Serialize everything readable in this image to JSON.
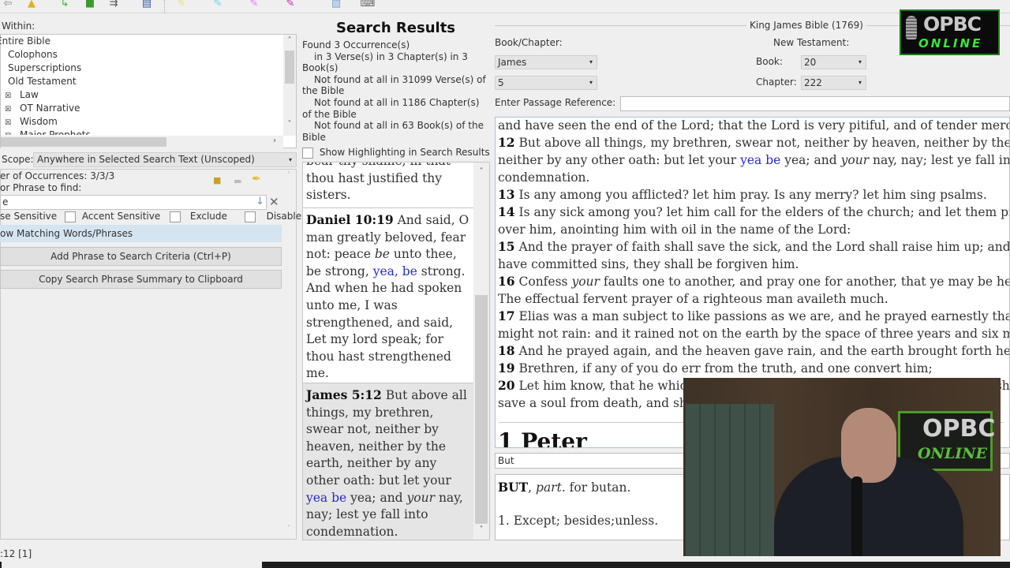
{
  "toolbar": {
    "icons": [
      "back-arrow-icon",
      "highlighter-eraser-icon",
      "green-arrow-forward-icon",
      "green-book-icon",
      "branch-arrow-icon",
      "window-layout-icon",
      "yellow-highlighter-icon",
      "cyan-highlighter-icon",
      "pink-highlighter-icon",
      "magenta-highlighter-icon",
      "notes-icon",
      "keyboard-icon"
    ]
  },
  "left": {
    "within_label": "Within:",
    "tree_items": [
      {
        "label": "Entire Bible",
        "checked": false,
        "indent": 0
      },
      {
        "label": "Colophons",
        "checked": false,
        "indent": 1
      },
      {
        "label": "Superscriptions",
        "checked": false,
        "indent": 1
      },
      {
        "label": "Old Testament",
        "checked": false,
        "indent": 1
      },
      {
        "label": "Law",
        "checked": true,
        "indent": 2
      },
      {
        "label": "OT Narrative",
        "checked": true,
        "indent": 2
      },
      {
        "label": "Wisdom",
        "checked": true,
        "indent": 2
      },
      {
        "label": "Major Prophets",
        "checked": true,
        "indent": 2
      }
    ],
    "scope_label": "Scope:",
    "scope_value": "Anywhere in Selected Search Text (Unscoped)",
    "occurrences_label": "er of Occurrences: 3/3/3",
    "phrase_label": "or Phrase to find:",
    "phrase_value": "e",
    "options": {
      "case_sensitive": "se Sensitive",
      "accent_sensitive": "Accent Sensitive",
      "exclude": "Exclude",
      "disable": "Disable"
    },
    "matching_label": "ow Matching Words/Phrases",
    "add_phrase_button": "Add Phrase to Search Criteria (Ctrl+P)",
    "copy_summary_button": "Copy Search Phrase Summary to Clipboard",
    "status": ":12 [1]"
  },
  "results": {
    "title": "Search Results",
    "summary": [
      {
        "text": "Found 3 Occurrence(s)",
        "indent": false
      },
      {
        "text": "in 3 Verse(s) in 3 Chapter(s) in 3 Book(s)",
        "indent": true
      },
      {
        "text": "Not found at all in 31099 Verse(s) of the Bible",
        "indent": true
      },
      {
        "text": "Not found at all in 1186 Chapter(s) of the Bible",
        "indent": true
      },
      {
        "text": "Not found at all in 63 Book(s) of the Bible",
        "indent": true
      }
    ],
    "show_highlighting_label": "Show Highlighting in Search Results",
    "items": [
      {
        "ref": "",
        "text_before": "bear thy shame, in that thou hast justified thy sisters.",
        "match": "",
        "text_after": ""
      },
      {
        "ref": "Daniel 10:19",
        "text_before": "And said, O man greatly beloved, fear not: peace ",
        "italic": "be",
        "text_mid": " unto thee, be strong, ",
        "match": "yea, be",
        "text_after": " strong. And when he had spoken unto me, I was strengthened, and said, Let my lord speak; for thou hast strengthened me."
      },
      {
        "ref": "James 5:12",
        "text_before": "But above all things, my brethren, swear not, neither by heaven, neither by the earth, neither by any other oath: but let your ",
        "match": "yea be",
        "text_mid": " yea; and ",
        "italic": "your",
        "text_after": " nay, nay; lest ye fall into condemnation."
      }
    ]
  },
  "bible": {
    "version_title": "King James Bible (1769)",
    "bookchapter_label": "Book/Chapter:",
    "book_value": "James",
    "chapter_value": "5",
    "testament_label": "New Testament:",
    "book_num_label": "Book:",
    "book_num_value": "20",
    "chapter_num_label": "Chapter:",
    "chapter_num_value": "222",
    "passage_label": "Enter Passage Reference:",
    "passage_value": "",
    "lines": [
      {
        "num": "",
        "parts": [
          {
            "t": "and have seen the end of the Lord; that the Lord is very pitiful, and of tender mercy."
          }
        ]
      },
      {
        "num": "12",
        "parts": [
          {
            "t": " But above all things, my brethren, swear not, neither by heaven, neither by the earth,"
          }
        ]
      },
      {
        "num": "",
        "parts": [
          {
            "t": "neither by any other oath: but let your "
          },
          {
            "t": "yea be",
            "s": "hl"
          },
          {
            "t": " yea; and "
          },
          {
            "t": "your",
            "s": "i"
          },
          {
            "t": " nay, nay; lest ye fall into"
          }
        ]
      },
      {
        "num": "",
        "parts": [
          {
            "t": "condemnation."
          }
        ]
      },
      {
        "num": "13",
        "parts": [
          {
            "t": " Is any among you afflicted? let him pray. Is any merry? let him sing psalms."
          }
        ]
      },
      {
        "num": "14",
        "parts": [
          {
            "t": " Is any sick among you? let him call for the elders of the church; and let them pray"
          }
        ]
      },
      {
        "num": "",
        "parts": [
          {
            "t": "over him, anointing him with oil in the name of the Lord:"
          }
        ]
      },
      {
        "num": "15",
        "parts": [
          {
            "t": " And the prayer of faith shall save the sick, and the Lord shall raise him up; and if he"
          }
        ]
      },
      {
        "num": "",
        "parts": [
          {
            "t": "have committed sins, they shall be forgiven him."
          }
        ]
      },
      {
        "num": "16",
        "parts": [
          {
            "t": " Confess "
          },
          {
            "t": "your",
            "s": "i"
          },
          {
            "t": " faults one to another, and pray one for another, that ye may be healed."
          }
        ]
      },
      {
        "num": "",
        "parts": [
          {
            "t": "The effectual fervent prayer of a righteous man availeth much."
          }
        ]
      },
      {
        "num": "17",
        "parts": [
          {
            "t": " Elias was a man subject to like passions as we are, and he prayed earnestly that it"
          }
        ]
      },
      {
        "num": "",
        "parts": [
          {
            "t": "might not rain: and it rained not on the earth by the space of three years and six months."
          }
        ]
      },
      {
        "num": "18",
        "parts": [
          {
            "t": " And he prayed again, and the heaven gave rain, and the earth brought forth her fruit."
          }
        ]
      },
      {
        "num": "19",
        "parts": [
          {
            "t": " Brethren, if any of you do err from the truth, and one convert him;"
          }
        ]
      },
      {
        "num": "20",
        "parts": [
          {
            "t": " Let him know, that he which converteth the sinner from the error of his way shall"
          }
        ]
      },
      {
        "num": "",
        "parts": [
          {
            "t": "save a soul from death, and shall hide a multitude of sins."
          }
        ]
      }
    ],
    "next_heading": "1 Peter"
  },
  "dictionary": {
    "lookup_word": "But",
    "headword": "BUT",
    "pos": "part.",
    "etymology": " for butan.",
    "definition": "1. Except; besides;unless."
  },
  "overlay": {
    "logo_top": "OPBC",
    "logo_bottom": "ONLINE"
  }
}
